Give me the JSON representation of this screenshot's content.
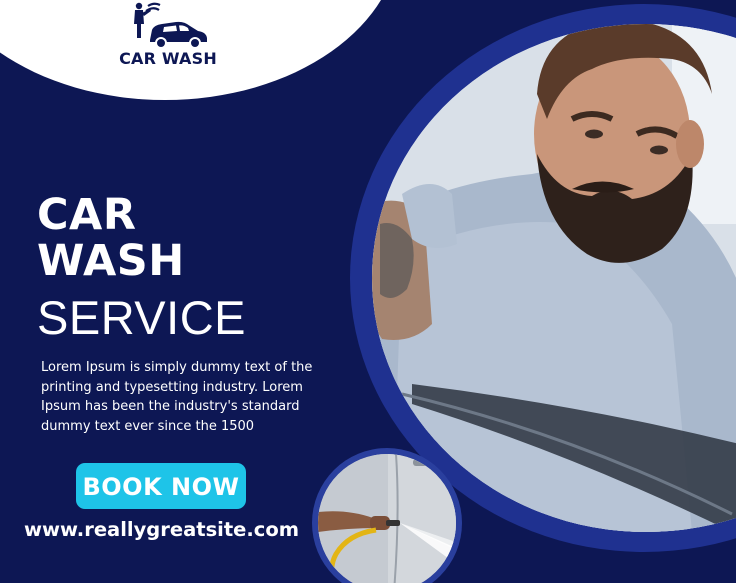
{
  "logo": {
    "text": "CAR WASH",
    "icon": "car-wash-icon"
  },
  "headline": {
    "line1": "CAR",
    "line2": "WASH",
    "line3": "SERVICE"
  },
  "description": "Lorem Ipsum is simply dummy text of the printing and typesetting industry. Lorem Ipsum has been the industry's standard dummy text ever since the 1500",
  "cta": {
    "label": "BOOK NOW"
  },
  "website": "www.reallygreatsite.com",
  "colors": {
    "background": "#0d1754",
    "ring": "#1f3190",
    "button": "#1ec4e8",
    "text": "#ffffff"
  },
  "images": {
    "main_photo": "man-inspecting-car-photo",
    "small_photo": "hose-spraying-car-photo"
  }
}
